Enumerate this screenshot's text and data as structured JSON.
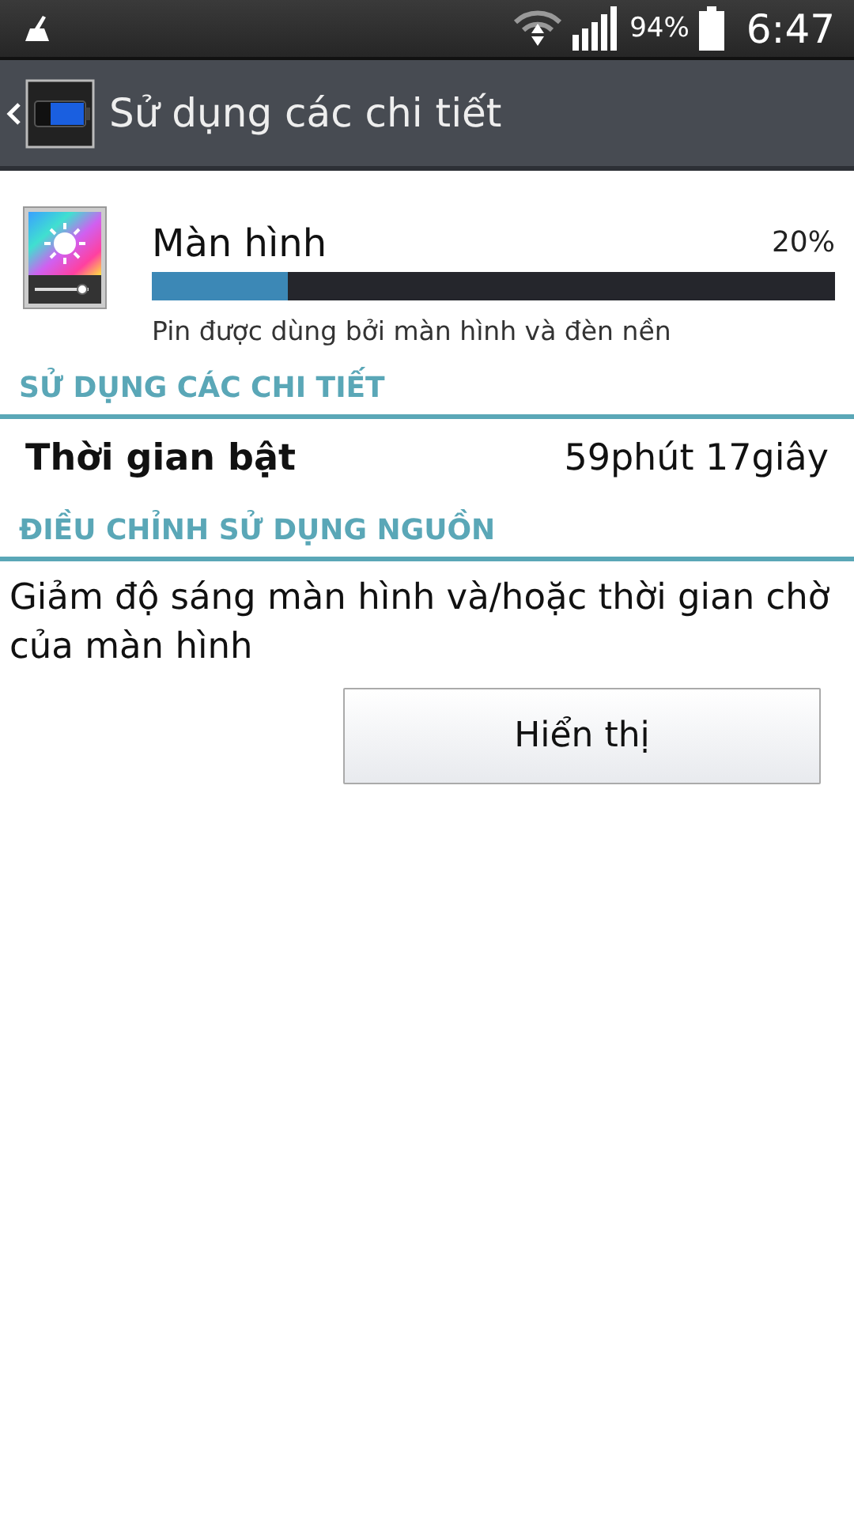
{
  "status_bar": {
    "battery": "94%",
    "time": "6:47"
  },
  "action_bar": {
    "title": "Sử dụng các chi tiết"
  },
  "usage_item": {
    "title": "Màn hình",
    "percent": "20%",
    "level": 0.2,
    "description": "Pin được dùng bởi màn hình và đèn nền"
  },
  "sections": [
    {
      "header": "SỬ DỤNG CÁC CHI TIẾT",
      "rows": [
        {
          "label": "Thời gian bật",
          "value": "59phút 17giây"
        }
      ]
    },
    {
      "header": "ĐIỀU CHỈNH SỬ DỤNG NGUỒN",
      "text": "Giảm độ sáng màn hình và/hoặc thời gian chờ của màn hình",
      "button": "Hiển thị"
    }
  ]
}
